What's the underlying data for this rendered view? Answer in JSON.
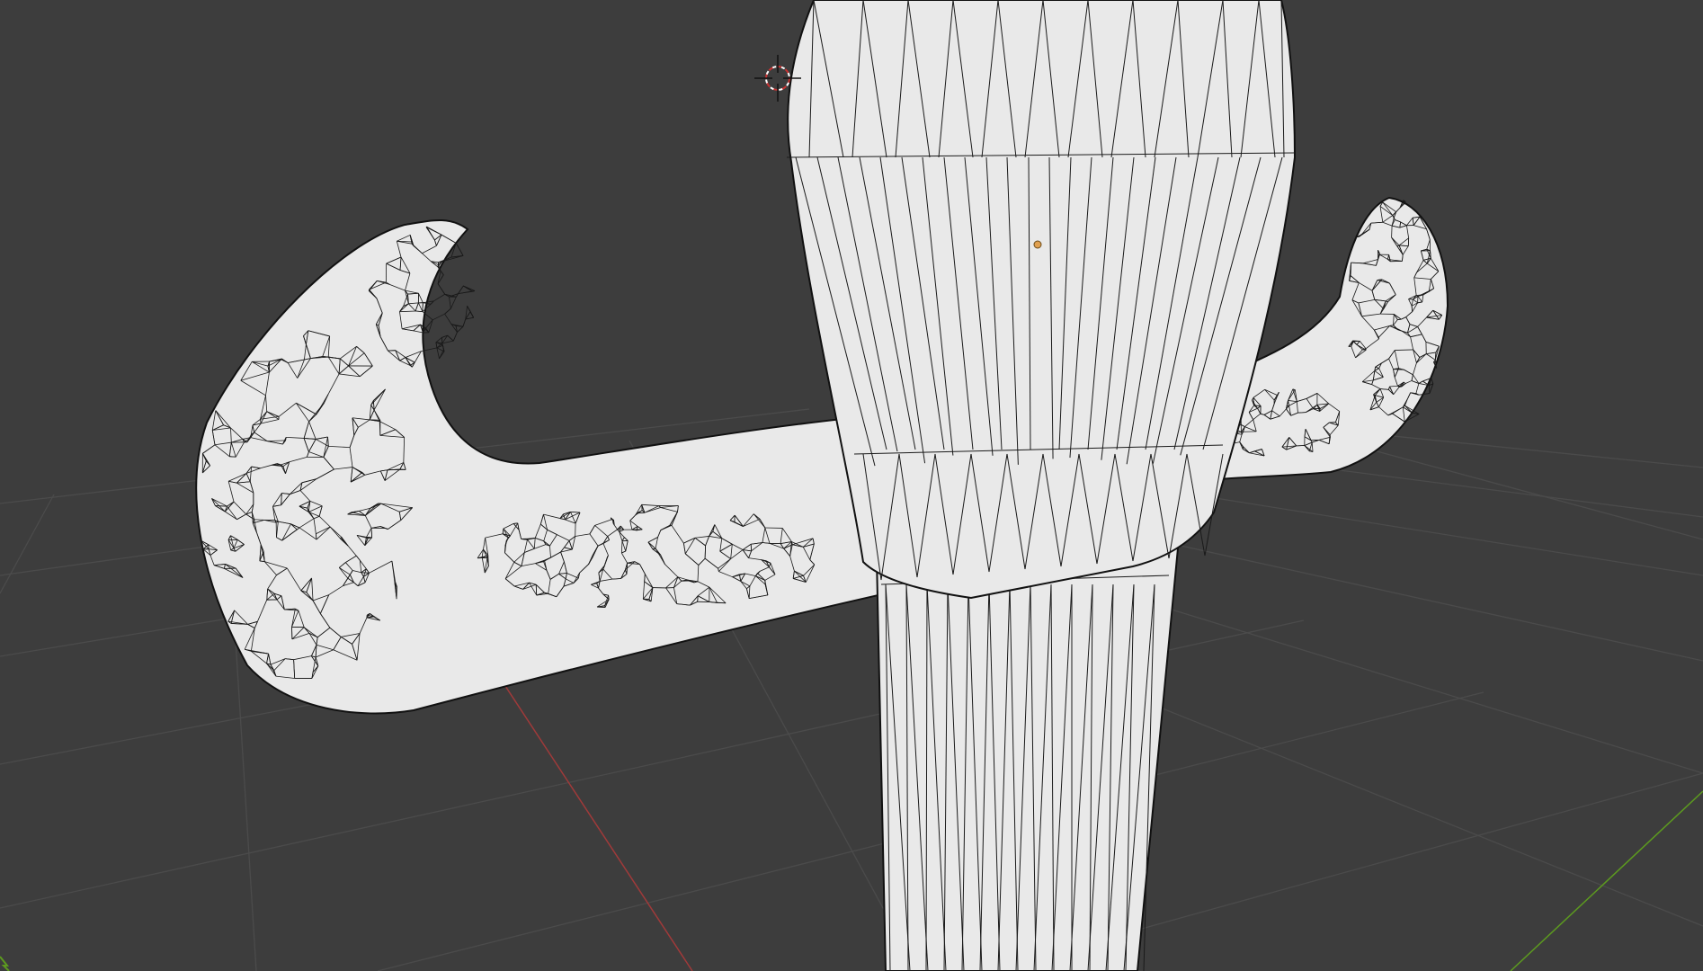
{
  "viewport": {
    "background": "#3d3d3d",
    "grid_color": "#4b4b4b",
    "x_axis_color": "#a03a3a",
    "y_axis_color": "#5c9a1f",
    "mesh_color": "#e9e9e9",
    "wire_color": "#1a1a1a",
    "cursor_color": "#c83232",
    "origin_color": "#e0a050"
  },
  "scene": {
    "object": "mesh",
    "display_mode": "wireframe-over-solid",
    "icons": [
      "3d-cursor-icon",
      "object-origin-icon",
      "axis-y-indicator-icon"
    ]
  }
}
